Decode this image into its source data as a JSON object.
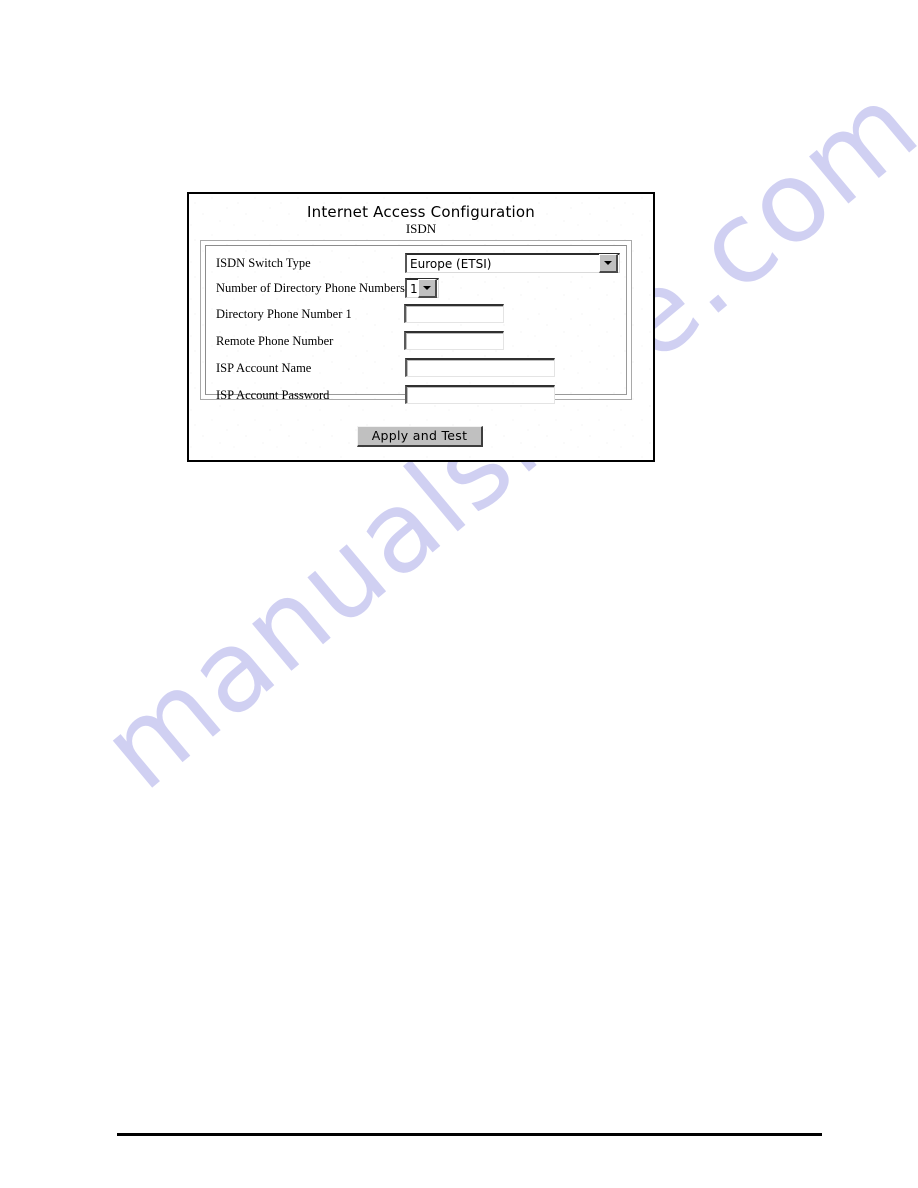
{
  "page": {
    "background_color": "#ffffff",
    "watermark": {
      "text": "manualshive.com",
      "color": "#c8c8f0"
    }
  },
  "dialog": {
    "title": "Internet Access Configuration",
    "subtitle": "ISDN",
    "border_color": "#000000",
    "face_color": "#ffffff",
    "rows": [
      {
        "label": "ISDN Switch Type",
        "control": "combobox",
        "value": "Europe (ETSI)"
      },
      {
        "label": "Number of Directory Phone Numbers",
        "control": "combobox",
        "value": "1"
      },
      {
        "label": "Directory Phone Number 1",
        "control": "textfield",
        "value": ""
      },
      {
        "label": "Remote Phone Number",
        "control": "textfield",
        "value": ""
      },
      {
        "label": "ISP Account Name",
        "control": "textfield",
        "value": ""
      },
      {
        "label": "ISP Account Password",
        "control": "textfield",
        "value": ""
      }
    ],
    "button": {
      "label": "Apply and Test",
      "face_color": "#c0c0c0"
    }
  }
}
